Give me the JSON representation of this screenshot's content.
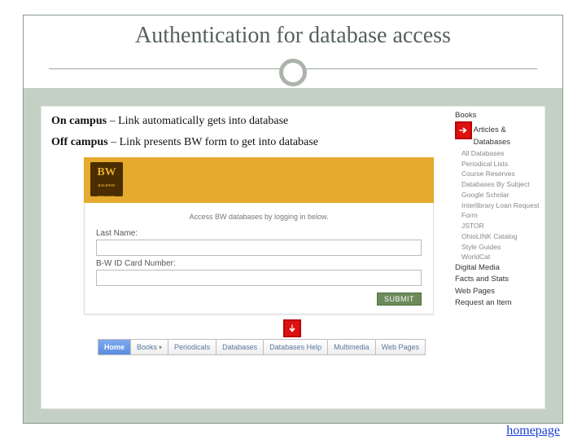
{
  "title": "Authentication for database access",
  "bullets": {
    "on_campus_bold": "On campus",
    "on_campus_rest": " – Link automatically gets into database",
    "off_campus_bold": "Off campus",
    "off_campus_rest": " – Link presents BW form to get into database"
  },
  "login": {
    "logo_main": "BW",
    "logo_sub": "BALDWIN WALLACE",
    "instruction": "Access BW databases by logging in below.",
    "last_name_label": "Last Name:",
    "id_label": "B-W ID Card Number:",
    "submit": "SUBMIT"
  },
  "side_menu": {
    "books": "Books",
    "articles": "Articles & Databases",
    "items": [
      "All Databases",
      "Periodical Lists",
      "Course Reserves",
      "Databases By Subject",
      "Google Scholar",
      "Interlibrary Loan Request Form",
      "JSTOR",
      "OhioLINK Catalog",
      "Style Guides",
      "WorldCat"
    ],
    "digital": "Digital Media",
    "facts": "Facts and Stats",
    "webpages": "Web Pages",
    "request": "Request an Item"
  },
  "tabs": {
    "home": "Home",
    "books": "Books",
    "periodicals": "Periodicals",
    "databases": "Databases",
    "db_help": "Databases Help",
    "multimedia": "Multimedia",
    "webpages": "Web Pages"
  },
  "homepage_link": "homepage"
}
